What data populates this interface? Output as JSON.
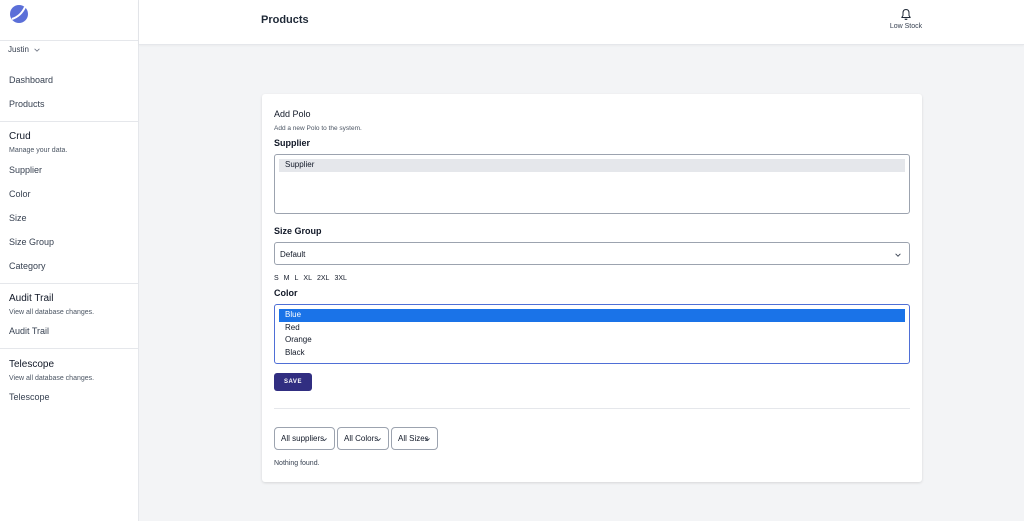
{
  "sidebar": {
    "user": "Justin",
    "nav": [
      {
        "label": "Dashboard"
      },
      {
        "label": "Products"
      }
    ],
    "crud": {
      "title": "Crud",
      "desc": "Manage your data.",
      "items": [
        {
          "label": "Supplier"
        },
        {
          "label": "Color"
        },
        {
          "label": "Size"
        },
        {
          "label": "Size Group"
        },
        {
          "label": "Category"
        }
      ]
    },
    "audit": {
      "title": "Audit Trail",
      "desc": "View all database changes.",
      "item": "Audit Trail"
    },
    "telescope": {
      "title": "Telescope",
      "desc": "View all database changes.",
      "item": "Telescope"
    }
  },
  "header": {
    "title": "Products",
    "notification_label": "Low Stock"
  },
  "form": {
    "title": "Add Polo",
    "desc": "Add a new Polo to the system.",
    "supplier_label": "Supplier",
    "supplier_options": [
      "Supplier"
    ],
    "size_group_label": "Size Group",
    "size_group_value": "Default",
    "sizes": [
      "S",
      "M",
      "L",
      "XL",
      "2XL",
      "3XL"
    ],
    "color_label": "Color",
    "color_options": [
      "Blue",
      "Red",
      "Orange",
      "Black"
    ],
    "save_label": "SAVE"
  },
  "filters": {
    "suppliers": "All suppliers",
    "colors": "All Colors",
    "sizes": "All Sizes"
  },
  "empty_message": "Nothing found.",
  "colors": {
    "accent": "#312e81",
    "selected_option": "#1a73e8",
    "focus_border": "#4f6fd6"
  }
}
